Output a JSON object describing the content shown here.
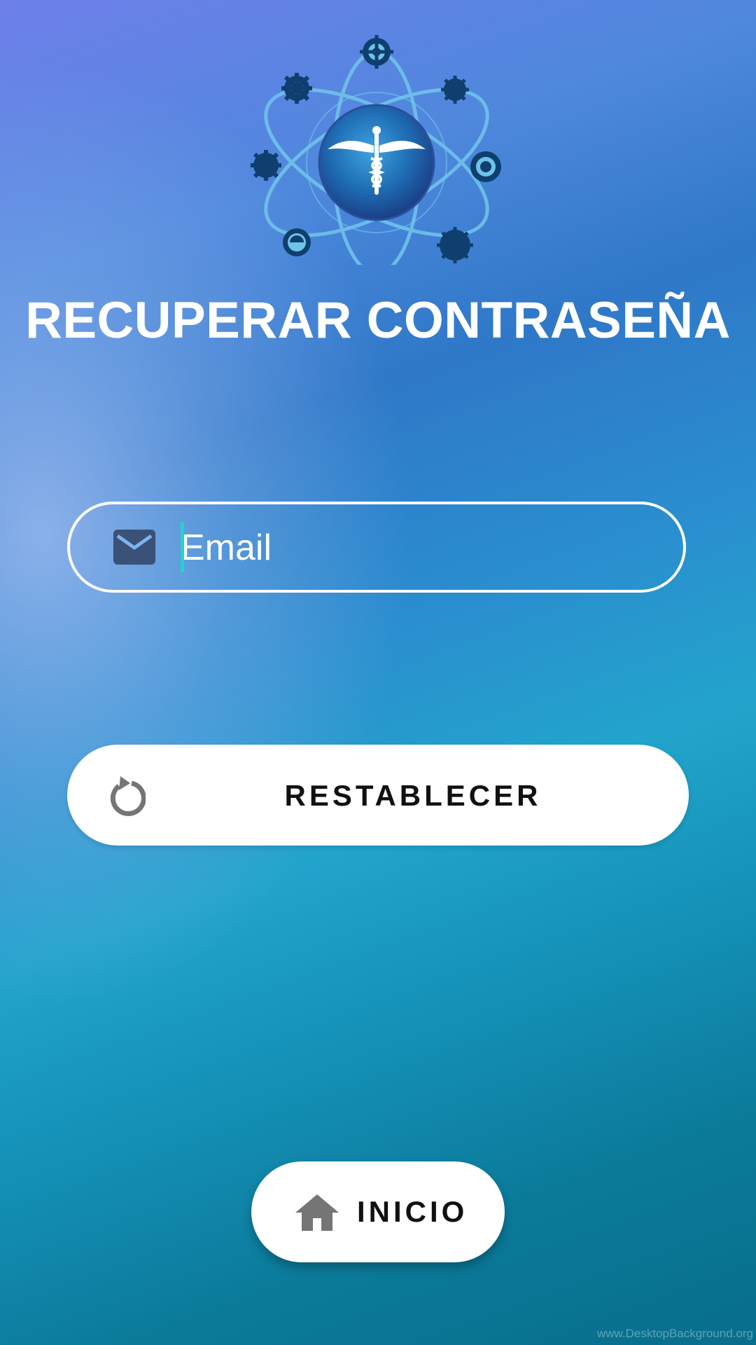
{
  "header": {
    "logo_name": "caduceus-atom-logo",
    "title": "RECUPERAR CONTRASEÑA"
  },
  "form": {
    "email_placeholder": "Email",
    "email_value": "",
    "email_icon": "mail-icon"
  },
  "actions": {
    "reset_label": "RESTABLECER",
    "reset_icon": "refresh-icon",
    "home_label": "INICIO",
    "home_icon": "home-icon"
  },
  "footer": {
    "watermark": "www.DesktopBackground.org"
  },
  "colors": {
    "accent_caret": "#1fd6c8",
    "text_light": "#ffffff",
    "button_bg": "#ffffff",
    "button_text": "#111111",
    "icon_gray": "#757575"
  }
}
